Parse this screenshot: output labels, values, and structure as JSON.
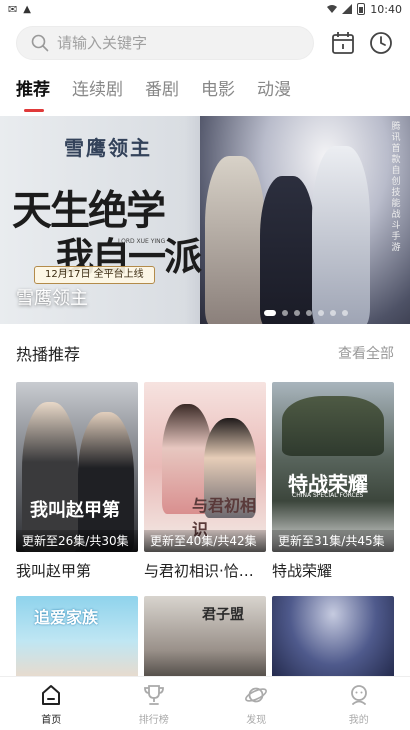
{
  "status": {
    "time": "10:40"
  },
  "search": {
    "placeholder": "请输入关键字",
    "calendar_icon": "calendar-icon",
    "history_icon": "clock-icon"
  },
  "tabs": [
    {
      "label": "推荐",
      "active": true
    },
    {
      "label": "连续剧",
      "active": false
    },
    {
      "label": "番剧",
      "active": false
    },
    {
      "label": "电影",
      "active": false
    },
    {
      "label": "动漫",
      "active": false
    }
  ],
  "banner": {
    "caption": "雪鹰领主",
    "logo": "雪鹰领主",
    "calligraphy_line1": "天生绝学",
    "calligraphy_line2": "我自一派",
    "lord_text": "LORD XUE YING",
    "release": "12月17日 全平台上线",
    "side_text": "腾讯首款自创技能战斗手游",
    "dot_count": 7,
    "active_dot": 0
  },
  "section": {
    "title": "热播推荐",
    "see_all": "查看全部"
  },
  "cards": [
    {
      "title": "我叫赵甲第",
      "badge": "更新至26集/共30集",
      "poster_text": "我叫赵甲第"
    },
    {
      "title": "与君初相识·恰似故人归",
      "badge": "更新至40集/共42集",
      "poster_text": "与君初相识"
    },
    {
      "title": "特战荣耀",
      "badge": "更新至31集/共45集",
      "poster_text": "特战荣耀",
      "poster_sub": "CHINA SPECIAL FORCES"
    }
  ],
  "row2": [
    {
      "poster_text": "追爱家族"
    },
    {
      "poster_text": "君子盟"
    },
    {
      "poster_text": ""
    }
  ],
  "nav": [
    {
      "label": "首页",
      "icon": "home-icon",
      "active": true
    },
    {
      "label": "排行榜",
      "icon": "trophy-icon",
      "active": false
    },
    {
      "label": "发现",
      "icon": "planet-icon",
      "active": false
    },
    {
      "label": "我的",
      "icon": "user-icon",
      "active": false
    }
  ],
  "colors": {
    "accent": "#e03a3a",
    "nav_inactive": "#aaaaaa"
  }
}
